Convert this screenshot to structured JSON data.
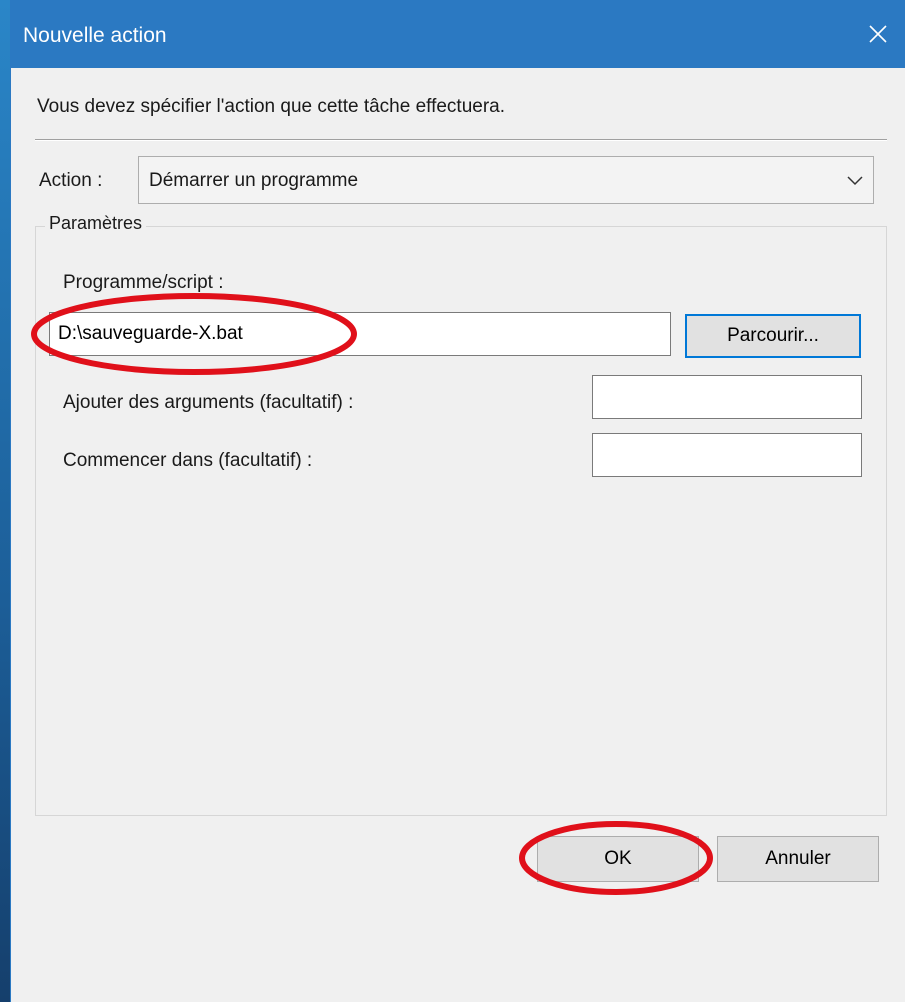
{
  "window": {
    "title": "Nouvelle action",
    "close_icon": "close-icon"
  },
  "instruction": "Vous devez spécifier l'action que cette tâche effectuera.",
  "action": {
    "label": "Action :",
    "selected": "Démarrer un programme"
  },
  "parameters": {
    "legend": "Paramètres",
    "program_label": "Programme/script :",
    "program_value": "D:\\sauveguarde-X.bat",
    "browse_label": "Parcourir...",
    "arguments_label": "Ajouter des arguments (facultatif) :",
    "arguments_value": "",
    "start_in_label": "Commencer dans (facultatif) :",
    "start_in_value": ""
  },
  "buttons": {
    "ok": "OK",
    "cancel": "Annuler"
  },
  "colors": {
    "titlebar": "#2b79c2",
    "annotation": "#e0101a",
    "default_button_border": "#0078d7"
  }
}
